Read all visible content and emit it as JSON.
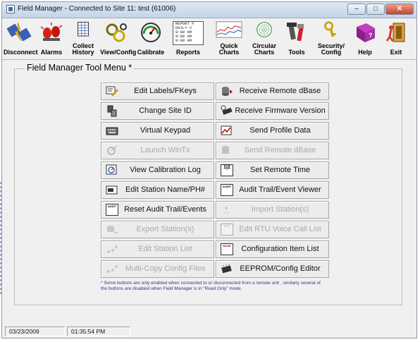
{
  "window": {
    "title": "Field Manager - Connected to Site 11: test (61006)",
    "controls": {
      "minimize": "–",
      "maximize": "□",
      "close": "✕"
    }
  },
  "toolbar": [
    {
      "id": "disconnect",
      "label": "Disconnect",
      "label2": "",
      "icon": "plug-disconnect-icon"
    },
    {
      "id": "alarms",
      "label": "Alarms",
      "label2": "",
      "icon": "alarm-lights-icon"
    },
    {
      "id": "collect-history",
      "label": "Collect",
      "label2": "History",
      "icon": "grid-page-icon"
    },
    {
      "id": "view-config",
      "label": "View/Config",
      "label2": "",
      "icon": "view-config-icon"
    },
    {
      "id": "calibrate",
      "label": "Calibrate",
      "label2": "",
      "icon": "gauge-icon"
    },
    {
      "id": "reports",
      "label": "Reports",
      "label2": "",
      "icon": "report-page-icon",
      "report_lines": [
        "REPORT F",
        "DAILY V",
        "9:00 AM",
        "9:00 AM",
        "9:00 AM"
      ]
    },
    {
      "id": "quick-charts",
      "label": "Quick",
      "label2": "Charts",
      "icon": "line-chart-icon"
    },
    {
      "id": "circular-charts",
      "label": "Circular",
      "label2": "Charts",
      "icon": "circular-chart-icon"
    },
    {
      "id": "tools",
      "label": "Tools",
      "label2": "",
      "icon": "tools-icon"
    },
    {
      "id": "security-config",
      "label": "Security/",
      "label2": "Config",
      "icon": "key-icon"
    },
    {
      "id": "help",
      "label": "Help",
      "label2": "",
      "icon": "help-book-icon"
    },
    {
      "id": "exit",
      "label": "Exit",
      "label2": "",
      "icon": "exit-door-icon"
    }
  ],
  "menu": {
    "title": "Field Manager Tool Menu *",
    "left": [
      {
        "label": "Edit Labels/FKeys",
        "enabled": true,
        "icon": "label-edit-icon"
      },
      {
        "label": "Change Site ID",
        "enabled": true,
        "icon": "change-site-icon"
      },
      {
        "label": "Virtual Keypad",
        "enabled": true,
        "icon": "keypad-icon"
      },
      {
        "label": "Launch WinTx",
        "enabled": false,
        "icon": "satellite-icon"
      },
      {
        "label": "View Calibration Log",
        "enabled": true,
        "icon": "calibration-log-icon"
      },
      {
        "label": "Edit Station Name/PH#",
        "enabled": true,
        "icon": "station-name-icon"
      },
      {
        "label": "Reset Audit Trail/Events",
        "enabled": true,
        "icon": "audit-reset-icon",
        "icon_text": "AUDIT"
      },
      {
        "label": "Export Station(s)",
        "enabled": false,
        "icon": "export-station-icon"
      },
      {
        "label": "Edit Station List",
        "enabled": false,
        "icon": "station-list-icon"
      },
      {
        "label": "Multi-Copy Config Files",
        "enabled": false,
        "icon": "multi-copy-icon"
      }
    ],
    "right": [
      {
        "label": "Receive Remote dBase",
        "enabled": true,
        "icon": "receive-db-icon"
      },
      {
        "label": "Receive Firmware Version",
        "enabled": true,
        "icon": "firmware-chip-icon"
      },
      {
        "label": "Send Profile Data",
        "enabled": true,
        "icon": "send-profile-icon"
      },
      {
        "label": "Send Remote dBase",
        "enabled": false,
        "icon": "send-db-icon"
      },
      {
        "label": "Set Remote Time",
        "enabled": true,
        "icon": "set-time-icon",
        "icon_text": "1|2"
      },
      {
        "label": "Audit Trail/Event Viewer",
        "enabled": true,
        "icon": "audit-viewer-icon",
        "icon_text": "AUDIT"
      },
      {
        "label": "Import Station(s)",
        "enabled": false,
        "icon": "import-station-icon"
      },
      {
        "label": "Edit RTU Voice Call List",
        "enabled": false,
        "icon": "voice-call-list-icon",
        "icon_text": "SCR"
      },
      {
        "label": "Configuration Item List",
        "enabled": true,
        "icon": "config-list-icon",
        "icon_text": "BASE"
      },
      {
        "label": "EEPROM/Config Editor",
        "enabled": true,
        "icon": "eeprom-icon"
      }
    ],
    "note": "* Some buttons are only enabled when connected to or disconnected from a remote unit , similarly several of the buttons are disabled when Field Manager is in \"Read Only\" mode."
  },
  "status": {
    "date": "03/23/2009",
    "time": "01:35:54 PM"
  }
}
